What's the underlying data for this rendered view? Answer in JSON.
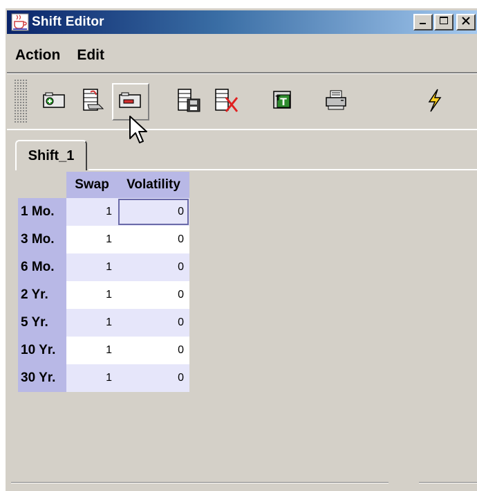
{
  "window": {
    "title": "Shift Editor",
    "icon": "java-cup-icon",
    "controls": [
      "minimize-icon",
      "maximize-icon",
      "close-icon"
    ]
  },
  "menubar": {
    "items": [
      {
        "label": "Action"
      },
      {
        "label": "Edit"
      }
    ]
  },
  "toolbar": {
    "buttons": [
      {
        "icon": "add-shift-icon"
      },
      {
        "icon": "open-shift-icon"
      },
      {
        "icon": "remove-shift-icon",
        "pressed": true
      },
      {
        "icon": "save-shift-icon"
      },
      {
        "icon": "delete-shift-icon"
      },
      {
        "icon": "tt-icon"
      },
      {
        "icon": "print-icon"
      },
      {
        "icon": "lightning-icon"
      }
    ]
  },
  "tabs": [
    {
      "label": "Shift_1",
      "selected": true
    }
  ],
  "grid": {
    "columns": [
      "Swap",
      "Volatility"
    ],
    "rows": [
      {
        "label": "1 Mo.",
        "swap": "1",
        "vol": "0"
      },
      {
        "label": "3 Mo.",
        "swap": "1",
        "vol": "0"
      },
      {
        "label": "6 Mo.",
        "swap": "1",
        "vol": "0"
      },
      {
        "label": "2 Yr.",
        "swap": "1",
        "vol": "0"
      },
      {
        "label": "5 Yr.",
        "swap": "1",
        "vol": "0"
      },
      {
        "label": "10 Yr.",
        "swap": "1",
        "vol": "0"
      },
      {
        "label": "30 Yr.",
        "swap": "1",
        "vol": "0"
      }
    ]
  },
  "colors": {
    "title_start": "#0a246a",
    "title_end": "#a6caf0",
    "header_bg": "#b8b8e6",
    "row_alt": "#e6e6fa",
    "window_bg": "#d4d0c8"
  }
}
